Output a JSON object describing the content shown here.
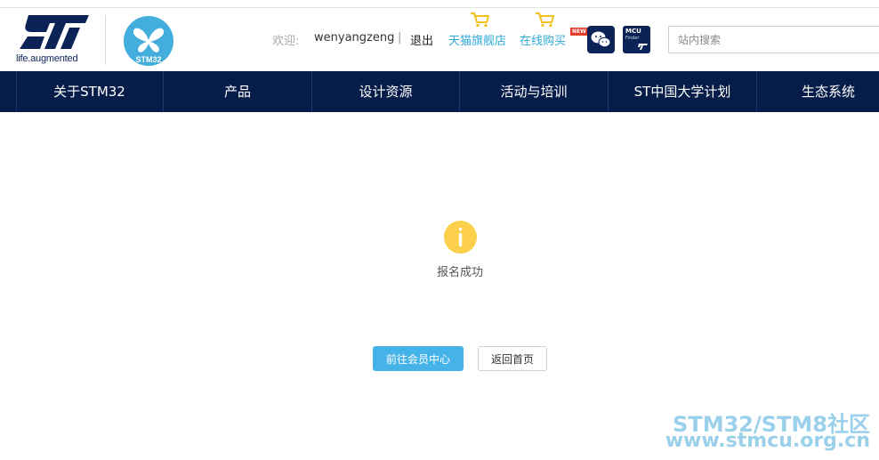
{
  "header": {
    "tagline": "life.augmented",
    "stm32_logo_text": "STM32",
    "welcome_label": "欢迎:",
    "username": "wenyangzeng",
    "separator": "|",
    "logout": "退出",
    "shop_tmall": "天猫旗舰店",
    "shop_online": "在线购买",
    "new_badge": "NEW",
    "mcu_finder_line1": "MCU",
    "mcu_finder_line2": "Finder",
    "search_placeholder": "站内搜索"
  },
  "nav": {
    "items": [
      {
        "label": "关于STM32"
      },
      {
        "label": "产品"
      },
      {
        "label": "设计资源"
      },
      {
        "label": "活动与培训"
      },
      {
        "label": "ST中国大学计划"
      },
      {
        "label": "生态系统"
      }
    ]
  },
  "main": {
    "message": "报名成功",
    "primary_button": "前往会员中心",
    "secondary_button": "返回首页"
  },
  "watermark": {
    "line1": "STM32/STM8社区",
    "line2": "www.stmcu.org.cn"
  },
  "colors": {
    "nav_bg": "#071d49",
    "brand_navy": "#0b2357",
    "accent_blue": "#45b3e8",
    "link_blue": "#2fa8d8",
    "info_yellow": "#fcd04d",
    "cart_yellow": "#f2c21a"
  }
}
